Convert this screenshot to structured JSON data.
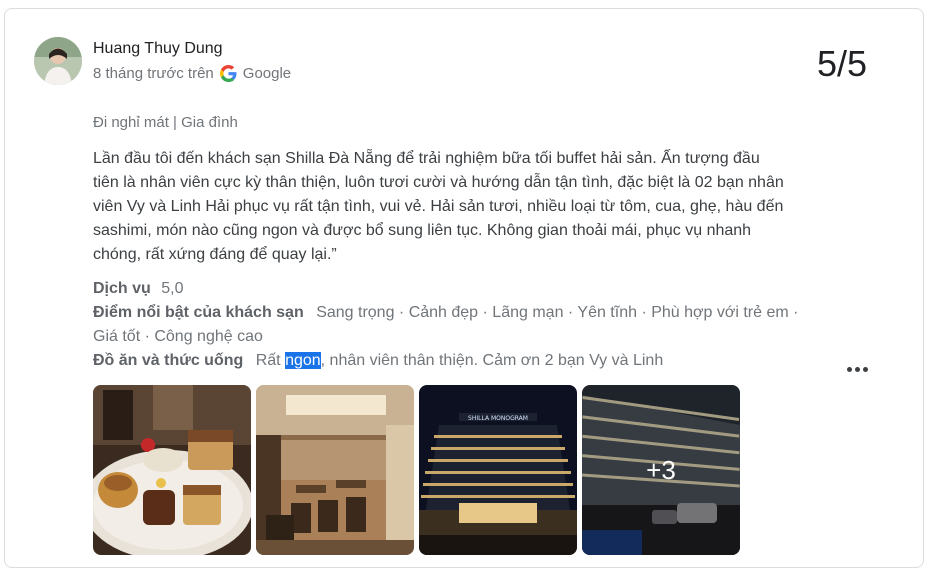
{
  "review": {
    "author": "Huang Thuy Dung",
    "time_ago": "8 tháng trước trên",
    "source": "Google",
    "rating": "5/5",
    "trip_type": "Đi nghỉ mát | Gia đình",
    "text_lines": [
      "Lần đầu tôi đến khách sạn Shilla Đà Nẵng để trải nghiệm bữa tối buffet hải sản. Ấn tượng đầu",
      "tiên là nhân viên cực kỳ thân thiện, luôn tươi cười và hướng dẫn tận tình, đặc biệt là 02 bạn nhân",
      "viên Vy và Linh Hải phục vụ rất tận tình, vui vẻ. Hải sản tươi, nhiều loại từ tôm, cua, ghẹ, hàu đến",
      "sashimi, món nào cũng ngon và được bổ sung liên tục. Không gian thoải mái, phục vụ nhanh",
      "chóng, rất xứng đáng để quay lại.”"
    ],
    "service_label": "Dịch vụ",
    "service_score": "5,0",
    "highlights_label": "Điểm nổi bật của khách sạn",
    "highlights_line1": "Sang trọng · Cảnh đẹp · Lãng mạn · Yên tĩnh · Phù hợp với trẻ em ·",
    "highlights_line2": "Giá tốt · Công nghệ cao",
    "food_label": "Đồ ăn và thức uống",
    "food_before": "Rất ",
    "food_highlight": "ngon",
    "food_after": ", nhân viên thân thiện. Cảm ơn 2 bạn Vy và Linh",
    "more_photos": "+3"
  }
}
